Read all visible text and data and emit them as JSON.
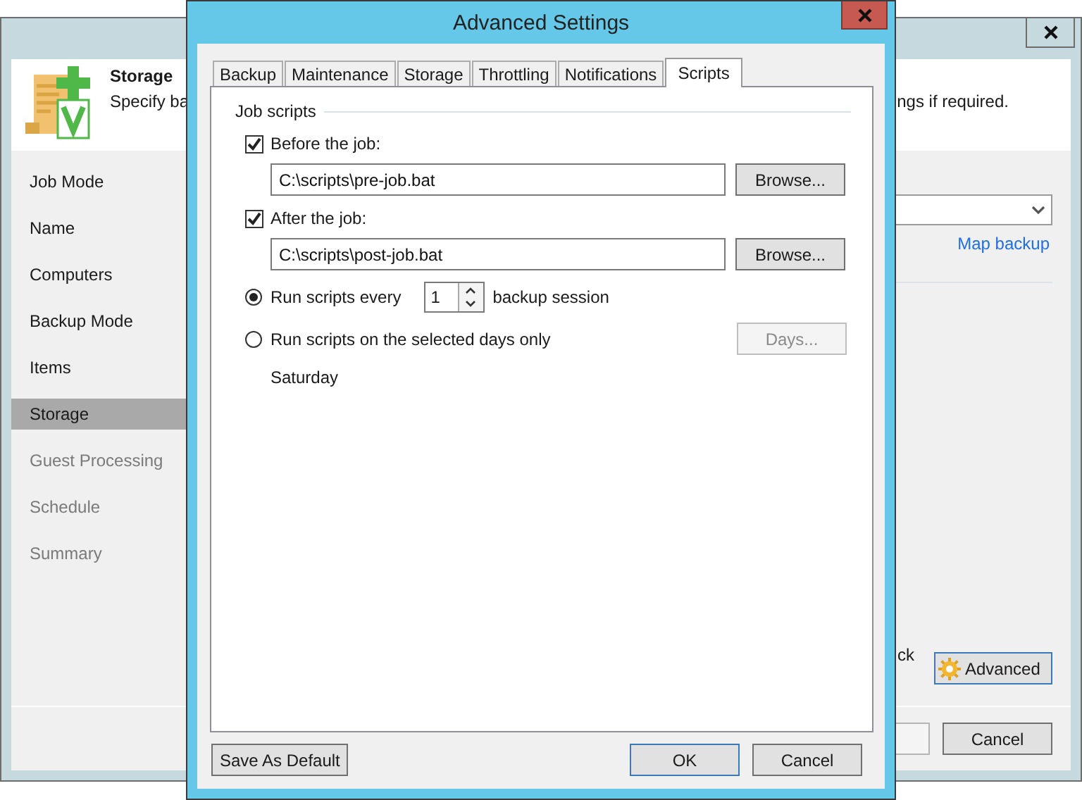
{
  "background_window": {
    "header": {
      "title": "Storage",
      "description_start": "Specify ba",
      "description_end": "ngs if required."
    },
    "steps": [
      {
        "label": "Job Mode",
        "selected": false,
        "disabled": false
      },
      {
        "label": "Name",
        "selected": false,
        "disabled": false
      },
      {
        "label": "Computers",
        "selected": false,
        "disabled": false
      },
      {
        "label": "Backup Mode",
        "selected": false,
        "disabled": false
      },
      {
        "label": "Items",
        "selected": false,
        "disabled": false
      },
      {
        "label": "Storage",
        "selected": true,
        "disabled": false
      },
      {
        "label": "Guest Processing",
        "selected": false,
        "disabled": true
      },
      {
        "label": "Schedule",
        "selected": false,
        "disabled": true
      },
      {
        "label": "Summary",
        "selected": false,
        "disabled": true
      }
    ],
    "map_link": "Map backup",
    "partial_text": "ck",
    "advanced_button": "Advanced",
    "cancel_button": "Cancel"
  },
  "dialog": {
    "title": "Advanced Settings",
    "tabs": [
      {
        "label": "Backup",
        "selected": false
      },
      {
        "label": "Maintenance",
        "selected": false
      },
      {
        "label": "Storage",
        "selected": false
      },
      {
        "label": "Throttling",
        "selected": false
      },
      {
        "label": "Notifications",
        "selected": false
      },
      {
        "label": "Scripts",
        "selected": true
      }
    ],
    "group_label": "Job scripts",
    "scripts": [
      {
        "label": "Before the job:",
        "checked": true,
        "path": "C:\\scripts\\pre-job.bat",
        "button": "Browse..."
      },
      {
        "label": "After the job:",
        "checked": true,
        "path": "C:\\scripts\\post-job.bat",
        "button": "Browse..."
      }
    ],
    "options": [
      {
        "kind": "every",
        "label": "Run scripts every",
        "selected": true,
        "value": "1",
        "suffix": "backup session"
      },
      {
        "kind": "days",
        "label": "Run scripts on the selected days only",
        "selected": false,
        "button": "Days...",
        "button_disabled": true
      }
    ],
    "days_text": "Saturday",
    "footer": {
      "save_default": "Save As Default",
      "ok": "OK",
      "cancel": "Cancel"
    }
  }
}
